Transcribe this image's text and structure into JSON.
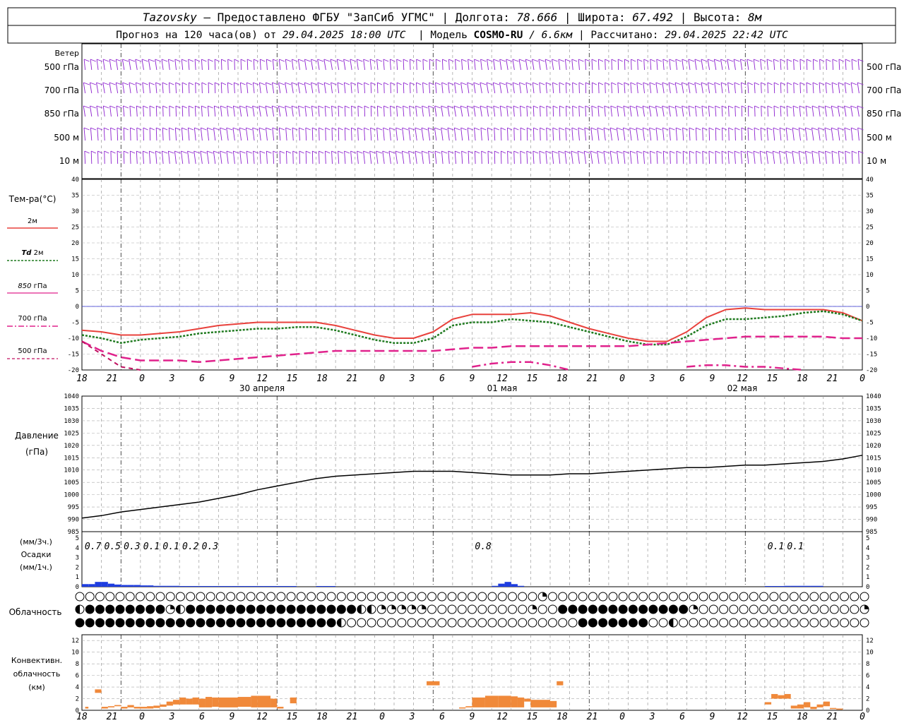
{
  "header": {
    "station": "Tazovsky",
    "provider": " — Предоставлено ФГБУ \"ЗапСиб УГМС\" | Долгота: ",
    "lon": "78.666",
    "lat_label": " | Широта: ",
    "lat": "67.492",
    "alt_label": " | Высота: ",
    "alt": "8м",
    "forecast_prefix": "Прогноз на 120 часа(ов) от ",
    "forecast_start": "29.04.2025 18:00 UTC",
    "model_label": "  | Модель ",
    "model": "COSMO-RU",
    "model_res": " / 6.6км",
    "calc_label": " | Рассчитано: ",
    "calc_time": "29.04.2025 22:42 UTC"
  },
  "wind_panel": {
    "title": "Ветер",
    "levels": [
      "500 гПа",
      "700 гПа",
      "850 гПа",
      "500 м",
      "10  м"
    ],
    "color": "#8c1fcf"
  },
  "x_axis": {
    "hours": [
      "18",
      "21",
      "0",
      "3",
      "6",
      "9",
      "12",
      "15",
      "18",
      "21",
      "0",
      "3",
      "6",
      "9",
      "12",
      "15",
      "18",
      "21",
      "0",
      "3",
      "6",
      "9",
      "12",
      "15",
      "18",
      "21",
      "0"
    ],
    "dates": [
      "30 апреля",
      "01 мая",
      "02 мая"
    ]
  },
  "legend_temp": {
    "title": "Тем-ра(°С)",
    "t2m": "2м",
    "td_a": "Td",
    "td_b": " 2м",
    "t850_a": "850",
    "t850_b": " гПа",
    "t700": "700 гПа",
    "t500": "500 гПа"
  },
  "pressure_labels": {
    "title": "Давление",
    "unit": "(гПа)"
  },
  "precip_labels": {
    "unit3": "(мм/3ч.)",
    "title": "Осадки",
    "unit1": "(мм/1ч.)"
  },
  "cloud_labels": {
    "title": "Облачность"
  },
  "conv_labels": {
    "l1": "Конвективн.",
    "l2": "облачность",
    "l3": "(км)"
  },
  "colors": {
    "t2m": "#e8413c",
    "td2m": "#1f7a1f",
    "t850": "#e0228c",
    "t700": "#e0228c",
    "t500": "#c01060",
    "pressure": "#000000",
    "precip": "#1e3de0",
    "conv": "#f0893a",
    "zero": "#3030d0"
  },
  "chart_data": [
    {
      "type": "line",
      "title": "Тем-ра(°С)",
      "ylim": [
        -20,
        40
      ],
      "yticks": [
        40,
        35,
        30,
        25,
        20,
        15,
        10,
        5,
        0,
        -5,
        -10,
        -15,
        -20
      ],
      "x_hours": [
        0,
        3,
        6,
        9,
        12,
        15,
        18,
        21,
        24,
        27,
        30,
        33,
        36,
        39,
        42,
        45,
        48,
        51,
        54,
        57,
        60,
        63,
        66,
        69,
        72,
        75,
        78,
        81,
        84,
        87,
        90,
        93,
        96,
        99,
        102,
        105,
        108,
        111,
        114,
        117,
        120
      ],
      "series": [
        {
          "name": "2м",
          "values": [
            -7.5,
            -8,
            -9,
            -9,
            -8.5,
            -8,
            -7,
            -6,
            -5.5,
            -5,
            -5,
            -5,
            -5,
            -6,
            -7.5,
            -9,
            -10,
            -10,
            -8,
            -4,
            -2.5,
            -2.5,
            -2.5,
            -2,
            -3,
            -5,
            -7,
            -8.5,
            -10,
            -11,
            -11,
            -8,
            -3.5,
            -1,
            -0.5,
            -1,
            -1,
            -1,
            -1,
            -2,
            -4.5
          ]
        },
        {
          "name": "Td 2м",
          "values": [
            -9,
            -10,
            -11.5,
            -10.5,
            -10,
            -9.5,
            -8.5,
            -8,
            -7.5,
            -7,
            -7,
            -6.5,
            -6.5,
            -7.5,
            -9,
            -10.5,
            -11.5,
            -11.5,
            -10,
            -6,
            -5,
            -5,
            -4,
            -4.5,
            -5,
            -6.5,
            -8,
            -9.5,
            -11,
            -12,
            -12,
            -9.5,
            -6,
            -4,
            -4,
            -3.5,
            -3,
            -2,
            -1.5,
            -2.5,
            -4.5
          ]
        },
        {
          "name": "850 гПа",
          "values": [
            -11,
            -14,
            -16,
            -17,
            -17,
            -17,
            -17.5,
            -17,
            -16.5,
            -16,
            -15.5,
            -15,
            -14.5,
            -14,
            -14,
            -14,
            -14,
            -14,
            -14,
            -13.5,
            -13,
            -13,
            -12.5,
            -12.5,
            -12.5,
            -12.5,
            -12.5,
            -12.5,
            -12.5,
            -12,
            -11.5,
            -11,
            -10.5,
            -10,
            -9.5,
            -9.5,
            -9.5,
            -9.5,
            -9.5,
            -10,
            -10
          ]
        },
        {
          "name": "700 гПа",
          "values": [
            null,
            null,
            null,
            null,
            null,
            null,
            null,
            null,
            null,
            null,
            null,
            null,
            null,
            null,
            null,
            null,
            null,
            null,
            null,
            null,
            -19,
            -18,
            -17.5,
            -17.5,
            -18.5,
            -20,
            null,
            null,
            null,
            null,
            null,
            -19,
            -18.5,
            -18.5,
            -19,
            -19,
            -19.5,
            -20,
            null,
            null,
            null
          ]
        },
        {
          "name": "500 гПа",
          "values": [
            -11,
            -15,
            -19,
            -20.5,
            null,
            null,
            null,
            null,
            null,
            null,
            null,
            null,
            null,
            null,
            null,
            null,
            null,
            null,
            null,
            null,
            null,
            null,
            null,
            null,
            null,
            null,
            null,
            null,
            null,
            null,
            null,
            null,
            null,
            null,
            null,
            null,
            null,
            null,
            null,
            null,
            null
          ]
        }
      ]
    },
    {
      "type": "line",
      "title": "Давление",
      "ylabel": "(гПа)",
      "ylim": [
        985,
        1040
      ],
      "yticks": [
        1040,
        1035,
        1030,
        1025,
        1020,
        1015,
        1010,
        1005,
        1000,
        995,
        990,
        985
      ],
      "x_hours": [
        0,
        3,
        6,
        9,
        12,
        15,
        18,
        21,
        24,
        27,
        30,
        33,
        36,
        39,
        42,
        45,
        48,
        51,
        54,
        57,
        60,
        63,
        66,
        69,
        72,
        75,
        78,
        81,
        84,
        87,
        90,
        93,
        96,
        99,
        102,
        105,
        108,
        111,
        114,
        117,
        120
      ],
      "series": [
        {
          "name": "Давление",
          "values": [
            990.5,
            991.5,
            993,
            994,
            995,
            996,
            997,
            998.5,
            1000,
            1002,
            1003.5,
            1005,
            1006.5,
            1007.5,
            1008,
            1008.5,
            1009,
            1009.5,
            1009.5,
            1009.5,
            1009,
            1008.5,
            1008,
            1008,
            1008,
            1008.5,
            1008.5,
            1009,
            1009.5,
            1010,
            1010.5,
            1011,
            1011,
            1011.5,
            1012,
            1012,
            1012.5,
            1013,
            1013.5,
            1014.5,
            1016,
            1017.5
          ]
        }
      ]
    },
    {
      "type": "bar",
      "title": "Осадки",
      "ylim": [
        0,
        5
      ],
      "yticks": [
        5,
        4,
        3,
        2,
        1,
        0
      ],
      "x_hours": [
        1,
        2,
        3,
        4,
        5,
        6,
        7,
        8,
        9,
        10,
        11,
        12,
        13,
        14,
        15,
        16,
        17,
        18,
        19,
        20,
        21,
        22,
        23,
        24,
        25,
        26,
        27,
        28,
        29,
        30,
        36,
        37,
        38,
        39,
        40,
        41,
        42,
        43,
        44,
        45,
        46,
        47,
        48,
        49,
        50,
        51,
        52,
        53,
        54,
        55,
        56,
        57,
        58,
        59,
        60,
        61,
        62,
        63,
        64,
        65,
        66,
        67,
        68,
        69,
        70,
        71,
        72,
        73,
        74,
        75,
        76,
        77,
        78,
        79,
        80,
        81,
        82,
        83,
        84,
        85,
        86,
        87,
        88,
        89,
        90,
        91,
        92,
        93,
        94,
        95,
        96,
        97,
        98,
        99,
        100,
        101,
        102,
        103,
        104,
        105,
        106,
        107,
        108,
        109,
        110,
        111,
        112,
        113,
        114,
        115,
        116,
        117,
        118,
        119,
        120
      ],
      "series": [
        {
          "name": "мм/1ч.",
          "values": [
            0.3,
            0.3,
            0.5,
            0.5,
            0.4,
            0.3,
            0.25,
            0.25,
            0.25,
            0.2,
            0.2,
            0.2,
            0.15,
            0.15,
            0.1,
            0.1,
            0.1,
            0.1,
            0.1,
            0.1,
            0.1,
            0.1,
            0.1,
            0.1,
            0.1,
            0.1,
            0.1,
            0.05,
            0.05,
            0.05,
            0.0,
            0.0,
            0.0,
            0.0,
            0.0,
            0.0,
            0.0,
            0.0,
            0.0,
            0.0,
            0.0,
            0.0,
            0.0,
            0.0,
            0.0,
            0.0,
            0.0,
            0.0,
            0.0,
            0.0,
            0.0,
            0.0,
            0.0,
            0.0,
            0.0,
            0.0,
            0.0,
            0.0,
            0.0,
            0.0,
            0.0,
            0.0,
            0.0,
            0.0,
            0.0,
            0.0,
            0.0,
            0.0,
            0.0,
            0.0,
            0.0,
            0.0,
            0.0,
            0.0,
            0.0,
            0.0,
            0.0,
            0.0,
            0.0,
            0.0,
            0.0,
            0.0,
            0.0,
            0.0,
            0.0,
            0.0,
            0.0,
            0.0,
            0.0,
            0.0,
            0.0,
            0.0,
            0.0,
            0.0,
            0.0,
            0.0,
            0.0,
            0.0,
            0.0,
            0.0,
            0.0,
            0.0,
            0.0,
            0.0,
            0.0,
            0.0,
            0.0,
            0.0,
            0.0,
            0.0,
            0.0,
            0.0,
            0.0,
            0.0,
            0.0
          ]
        }
      ],
      "bars_1h": [
        [
          1,
          0.3
        ],
        [
          2,
          0.3
        ],
        [
          3,
          0.55
        ],
        [
          4,
          0.55
        ],
        [
          5,
          0.35
        ],
        [
          6,
          0.25
        ],
        [
          7,
          0.2
        ],
        [
          8,
          0.2
        ],
        [
          9,
          0.2
        ],
        [
          10,
          0.15
        ],
        [
          11,
          0.15
        ],
        [
          12,
          0.1
        ],
        [
          13,
          0.1
        ],
        [
          14,
          0.1
        ],
        [
          15,
          0.1
        ],
        [
          16,
          0.08
        ],
        [
          17,
          0.05
        ],
        [
          18,
          0.05
        ],
        [
          19,
          0.05
        ],
        [
          20,
          0.08
        ],
        [
          21,
          0.08
        ],
        [
          22,
          0.05
        ],
        [
          23,
          0.05
        ],
        [
          24,
          0.05
        ],
        [
          25,
          0.05
        ],
        [
          26,
          0.05
        ],
        [
          27,
          0.05
        ],
        [
          28,
          0.05
        ],
        [
          29,
          0.05
        ],
        [
          30,
          0.05
        ],
        [
          31,
          0.05
        ],
        [
          32,
          0.05
        ],
        [
          33,
          0.05
        ],
        [
          37,
          0.05
        ],
        [
          38,
          0.05
        ],
        [
          39,
          0.05
        ],
        [
          64,
          0.1
        ],
        [
          65,
          0.35
        ],
        [
          66,
          0.55
        ],
        [
          67,
          0.3
        ],
        [
          68,
          0.1
        ],
        [
          106,
          0.05
        ],
        [
          107,
          0.05
        ],
        [
          108,
          0.05
        ],
        [
          109,
          0.1
        ],
        [
          110,
          0.1
        ],
        [
          111,
          0.1
        ],
        [
          112,
          0.1
        ],
        [
          113,
          0.1
        ],
        [
          114,
          0.1
        ]
      ],
      "labels_3h": [
        {
          "x": 3,
          "text": "0.7"
        },
        {
          "x": 6,
          "text": "0.5"
        },
        {
          "x": 9,
          "text": "0.3"
        },
        {
          "x": 12,
          "text": "0.1"
        },
        {
          "x": 15,
          "text": "0.1"
        },
        {
          "x": 18,
          "text": "0.2"
        },
        {
          "x": 21,
          "text": "0.3"
        },
        {
          "x": 63,
          "text": "0.8"
        },
        {
          "x": 108,
          "text": "0.1"
        },
        {
          "x": 111,
          "text": "0.1"
        }
      ]
    },
    {
      "type": "bar",
      "title": "Конвективн. облачность (км)",
      "ylim": [
        0,
        13
      ],
      "yticks": [
        12,
        10,
        8,
        6,
        4,
        2,
        0
      ],
      "bars": [
        [
          0.5,
          1,
          0.3,
          0.6
        ],
        [
          2,
          3,
          3.0,
          3.6
        ],
        [
          3,
          4,
          0.3,
          0.6
        ],
        [
          4,
          5,
          0.5,
          0.7
        ],
        [
          5,
          6,
          0.7,
          0.9
        ],
        [
          6,
          7,
          0.3,
          0.6
        ],
        [
          7,
          8,
          0.5,
          0.9
        ],
        [
          8,
          10,
          0.3,
          0.6
        ],
        [
          10,
          11,
          0.3,
          0.7
        ],
        [
          11,
          12,
          0.4,
          0.8
        ],
        [
          12,
          13,
          0.6,
          1.0
        ],
        [
          13,
          14,
          0.8,
          1.5
        ],
        [
          14,
          15,
          1.0,
          1.8
        ],
        [
          15,
          16,
          1.0,
          2.2
        ],
        [
          16,
          17,
          1.0,
          2.0
        ],
        [
          17,
          18,
          1.0,
          2.2
        ],
        [
          18,
          19,
          0.5,
          2.0
        ],
        [
          19,
          20,
          0.5,
          2.3
        ],
        [
          20,
          21,
          0.6,
          2.2
        ],
        [
          21,
          24,
          0.5,
          2.2
        ],
        [
          24,
          26,
          0.6,
          2.3
        ],
        [
          26,
          27,
          0.5,
          2.5
        ],
        [
          27,
          29,
          0.5,
          2.5
        ],
        [
          29,
          30,
          0.5,
          2.0
        ],
        [
          30,
          31,
          0.3,
          0.6
        ],
        [
          32,
          33,
          1.2,
          2.2
        ],
        [
          53,
          55,
          4.3,
          5.0
        ],
        [
          58,
          59,
          0.3,
          0.5
        ],
        [
          59,
          60,
          0.5,
          0.7
        ],
        [
          60,
          62,
          0.5,
          2.2
        ],
        [
          62,
          64,
          0.5,
          2.5
        ],
        [
          64,
          66,
          0.5,
          2.5
        ],
        [
          66,
          67,
          0.5,
          2.4
        ],
        [
          67,
          68,
          0.5,
          2.2
        ],
        [
          68,
          69,
          1.5,
          2.0
        ],
        [
          69,
          72,
          0.5,
          1.8
        ],
        [
          72,
          73,
          0.5,
          1.6
        ],
        [
          73,
          74,
          4.3,
          5.0
        ],
        [
          105,
          106,
          1.0,
          1.4
        ],
        [
          106,
          107,
          2.0,
          2.8
        ],
        [
          107,
          108,
          2.0,
          2.6
        ],
        [
          108,
          109,
          2.0,
          2.8
        ],
        [
          109,
          110,
          0.3,
          0.8
        ],
        [
          110,
          111,
          0.3,
          1.0
        ],
        [
          111,
          112,
          0.5,
          1.4
        ],
        [
          112,
          113,
          0.2,
          0.6
        ],
        [
          113,
          114,
          0.5,
          1.0
        ],
        [
          114,
          115,
          0.7,
          1.5
        ],
        [
          115,
          116,
          0.2,
          0.4
        ],
        [
          116,
          117,
          0.1,
          0.3
        ]
      ]
    },
    {
      "type": "table",
      "title": "Облачность",
      "rows": [
        "0000000000000000000000000000000000000000000000Q000000000000000000000000000000000000000000000000000000000000000000000000000Q",
        "H44444444QH44444444444444444HHQQQQQ0000000000Q004444444444444Q0000000000000000QQQQQQQQQQQQQ0000004444444444QQQQQQQ",
        "44444444444444444444444444H00000000000000000000000444444400H000000000000000000000000000000000044444444444H0444444"
      ]
    }
  ]
}
